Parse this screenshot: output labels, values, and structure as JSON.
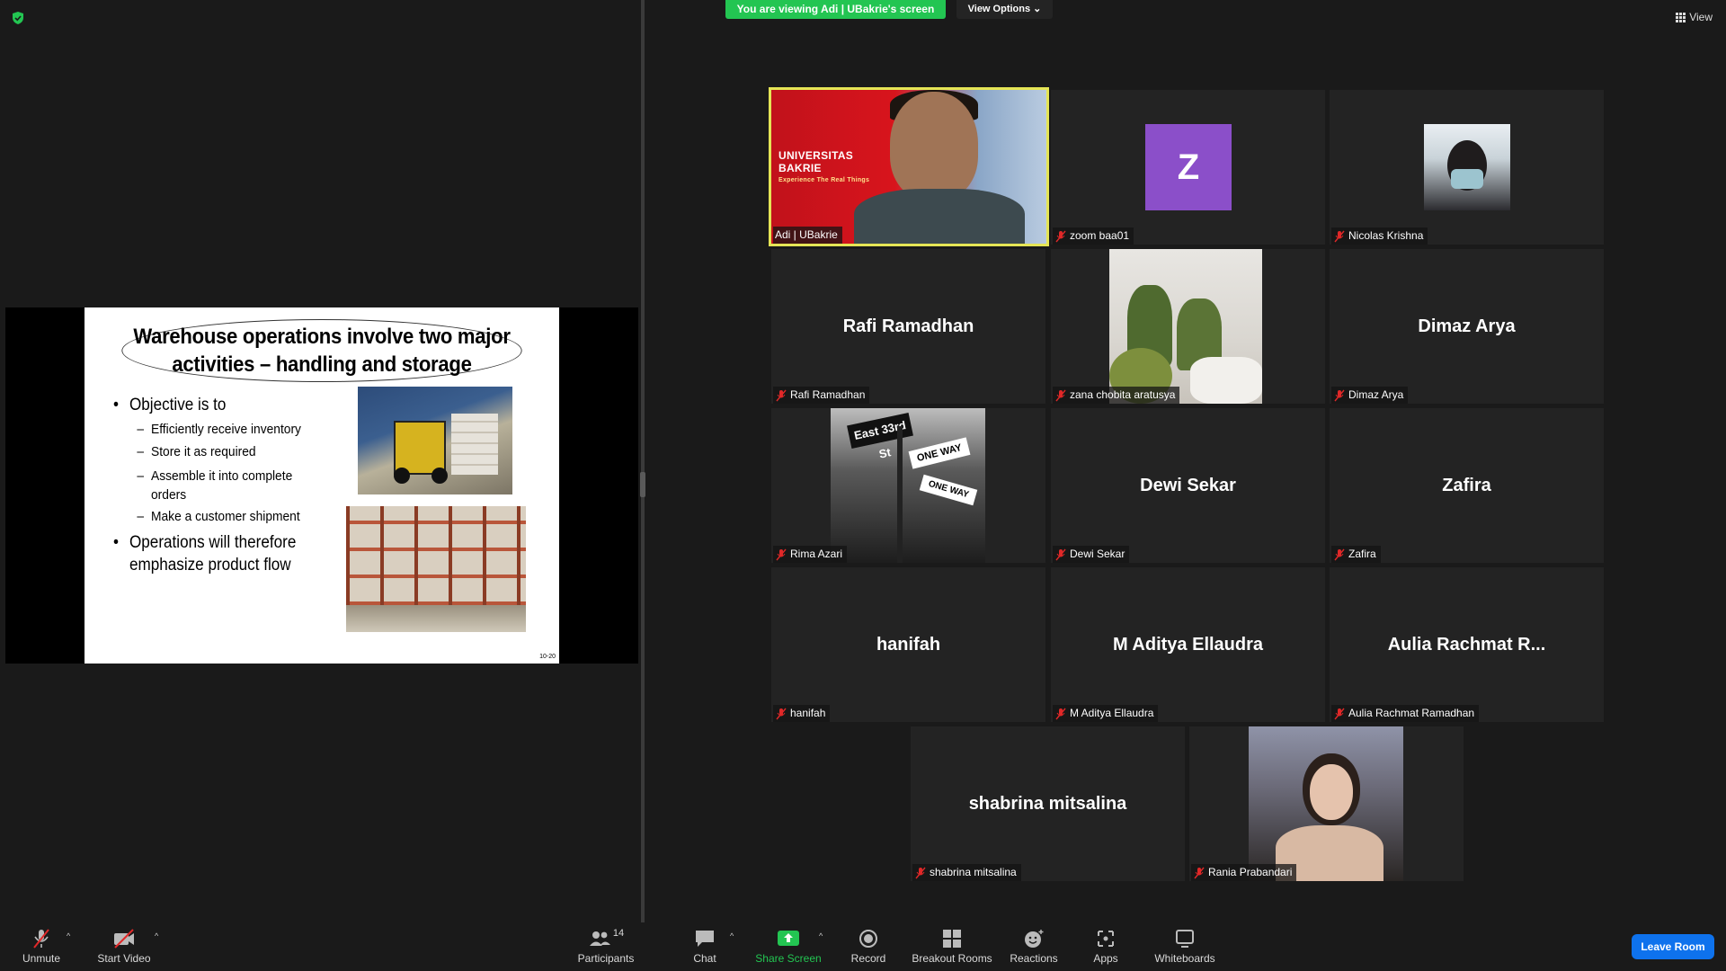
{
  "banner": {
    "text": "You are viewing Adi | UBakrie's screen",
    "view_options": "View Options ⌄"
  },
  "view_button": "View",
  "slide": {
    "title": "Warehouse operations involve two major activities – handling and storage",
    "bullet1": "Objective is to",
    "subs": [
      "Efficiently receive inventory",
      "Store it as required",
      "Assemble it into complete orders",
      "Make a customer shipment"
    ],
    "bullet2": "Operations will therefore emphasize product flow",
    "page": "10-20"
  },
  "host": {
    "line1": "UNIVERSITAS",
    "line2": "BAKRIE",
    "tagline": "Experience The Real Things"
  },
  "tiles": [
    {
      "label": "Adi | UBakrie"
    },
    {
      "label": "zoom baa01",
      "avatar": "Z"
    },
    {
      "label": "Nicolas Krishna"
    },
    {
      "label": "Rafi Ramadhan",
      "center": "Rafi Ramadhan"
    },
    {
      "label": "zana chobita aratusya"
    },
    {
      "label": "Dimaz Arya",
      "center": "Dimaz Arya"
    },
    {
      "label": "Rima Azari"
    },
    {
      "label": "Dewi Sekar",
      "center": "Dewi Sekar"
    },
    {
      "label": "Zafira",
      "center": "Zafira"
    },
    {
      "label": "hanifah",
      "center": "hanifah"
    },
    {
      "label": "M Aditya Ellaudra",
      "center": "M Aditya Ellaudra"
    },
    {
      "label": "Aulia Rachmat Ramadhan",
      "center": "Aulia  Rachmat  R..."
    },
    {
      "label": "shabrina mitsalina",
      "center": "shabrina mitsalina"
    },
    {
      "label": "Rania Prabandari"
    }
  ],
  "street_sign": {
    "street": "East 33rd St",
    "one_way": "ONE WAY"
  },
  "toolbar": {
    "unmute": "Unmute",
    "start_video": "Start Video",
    "participants": "Participants",
    "participants_count": "14",
    "chat": "Chat",
    "share_screen": "Share Screen",
    "record": "Record",
    "breakout": "Breakout Rooms",
    "reactions": "Reactions",
    "apps": "Apps",
    "whiteboards": "Whiteboards",
    "leave": "Leave Room"
  },
  "colors": {
    "accent_green": "#23c552",
    "leave_blue": "#0e72ed",
    "active_border": "#e5e556",
    "avatar_purple": "#8b4fc9"
  }
}
